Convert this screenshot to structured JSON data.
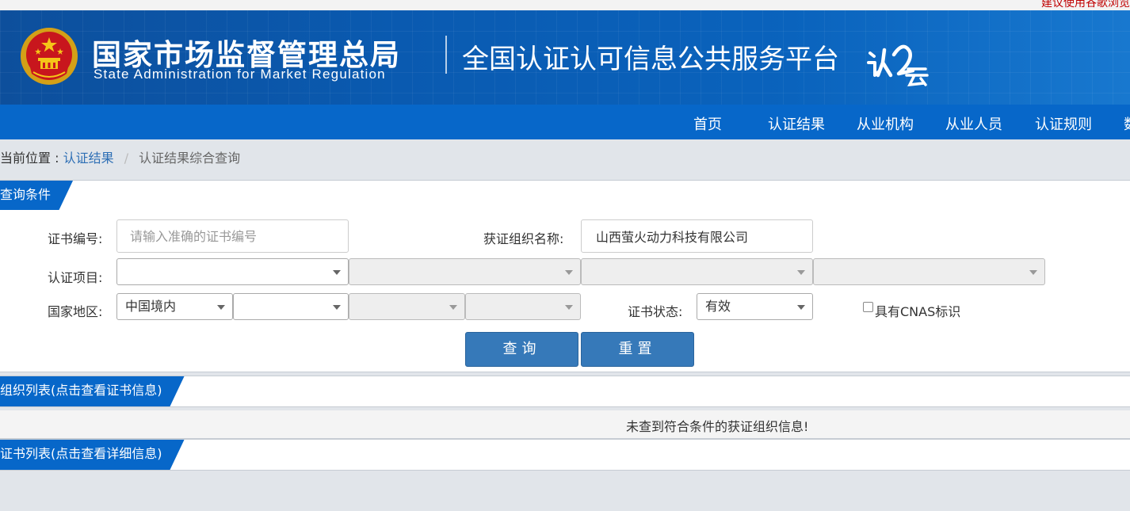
{
  "top_hint": "建议使用谷歌浏览器",
  "header": {
    "org_cn": "国家市场监督管理总局",
    "org_en": "State Administration  for  Market Regulation",
    "platform": "全国认证认可信息公共服务平台",
    "logo_icon": "renyun-logo"
  },
  "nav": {
    "items": [
      {
        "label": "首页"
      },
      {
        "label": "认证结果"
      },
      {
        "label": "从业机构"
      },
      {
        "label": "从业人员"
      },
      {
        "label": "认证规则"
      },
      {
        "label": "数"
      }
    ]
  },
  "breadcrumb": {
    "prefix": "当前位置 :",
    "link": "认证结果",
    "separator": "/",
    "current": "认证结果综合查询"
  },
  "query": {
    "section_title": "查询条件",
    "cert_no_label": "证书编号:",
    "cert_no_placeholder": "请输入准确的证书编号",
    "cert_no_value": "",
    "org_name_label": "获证组织名称:",
    "org_name_value": "山西萤火动力科技有限公司",
    "project_label": "认证项目:",
    "project_values": [
      "",
      "",
      "",
      ""
    ],
    "region_label": "国家地区:",
    "region_values": [
      "中国境内",
      "",
      "",
      ""
    ],
    "status_label": "证书状态:",
    "status_value": "有效",
    "cnas_label": "具有CNAS标识",
    "search_button": "查询",
    "reset_button": "重置"
  },
  "org_list": {
    "section_title": "组织列表(点击查看证书信息)",
    "empty_message": "未查到符合条件的获证组织信息!"
  },
  "cert_list": {
    "section_title": "证书列表(点击查看详细信息)"
  },
  "colors": {
    "brand_blue": "#0767c9",
    "button_blue": "#3679b9",
    "link_blue": "#2e6fb5"
  }
}
